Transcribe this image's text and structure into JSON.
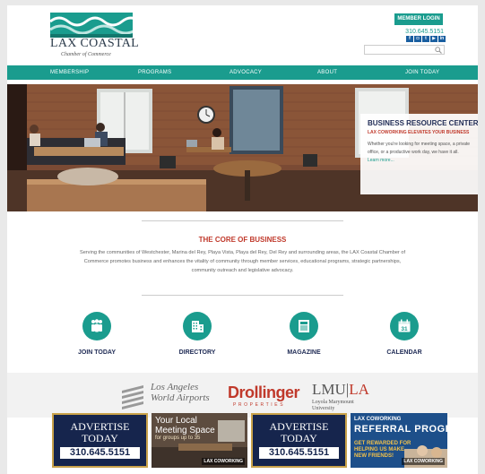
{
  "header": {
    "logo_title": "LAX COASTAL",
    "logo_subtitle": "Chamber of Commerce",
    "member_login": "MEMBER LOGIN",
    "phone": "310.645.5151",
    "social_icons": [
      "facebook-icon",
      "instagram-icon",
      "twitter-icon",
      "youtube-icon",
      "linkedin-icon"
    ],
    "search_placeholder": ""
  },
  "nav": {
    "items": [
      {
        "label": "MEMBERSHIP"
      },
      {
        "label": "PROGRAMS"
      },
      {
        "label": "ADVOCACY"
      },
      {
        "label": "ABOUT"
      },
      {
        "label": "JOIN TODAY"
      }
    ]
  },
  "hero": {
    "card_title": "BUSINESS RESOURCE CENTER",
    "card_subtitle": "LAX COWORKING ELEVATES YOUR BUSINESS",
    "card_body": "Whether you're looking for meeting space, a private office, or a productive work day, we have it all.",
    "card_link": "Learn more..."
  },
  "core": {
    "title": "THE CORE OF BUSINESS",
    "text": "Serving the communities of Westchester, Marina del Rey, Playa Vista, Playa del Rey, Del Rey and surrounding areas, the LAX Coastal Chamber of Commerce promotes business and enhances the vitality of community through member services, educational programs, strategic partnerships, community outreach and legislative advocacy."
  },
  "quick_links": [
    {
      "label": "JOIN TODAY",
      "icon": "people-icon"
    },
    {
      "label": "DIRECTORY",
      "icon": "building-icon"
    },
    {
      "label": "MAGAZINE",
      "icon": "newspaper-icon"
    },
    {
      "label": "CALENDAR",
      "icon": "calendar-icon"
    }
  ],
  "calendar_day": "31",
  "partners": {
    "lawa_line1": "Los Angeles",
    "lawa_line2": "World Airports",
    "drollinger": "Drollinger",
    "drollinger_sub": "PROPERTIES",
    "lmu_left": "LMU",
    "lmu_right": "LA",
    "lmu_sub1": "Loyola Marymount",
    "lmu_sub2": "University"
  },
  "ads": {
    "advertise_l1": "ADVERTISE",
    "advertise_l2": "TODAY",
    "advertise_phone": "310.645.5151",
    "meeting_l1": "Your Local",
    "meeting_l2": "Meeting Space",
    "meeting_l3": "for groups up to 35",
    "brand": "LAX COWORKING",
    "referral_l1": "LAX COWORKING",
    "referral_l2": "REFERRAL PROGRAM",
    "referral_l3": "GET REWARDED FOR HELPING US MAKE NEW FRIENDS!"
  },
  "colors": {
    "teal": "#1a9c8e",
    "navy": "#1f2b55",
    "red": "#c0392b"
  }
}
